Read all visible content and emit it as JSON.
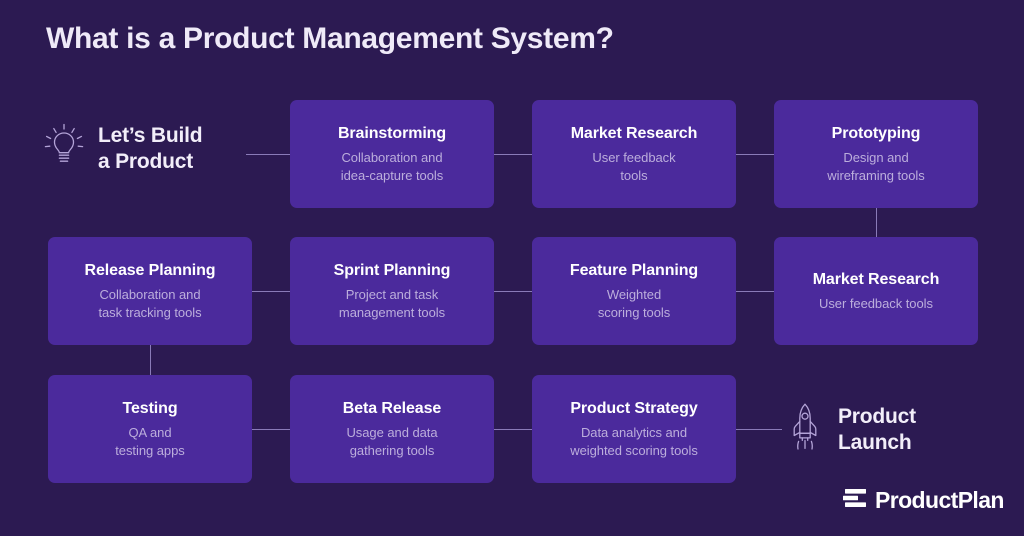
{
  "header": {
    "title": "What is a Product Management System?"
  },
  "colors": {
    "background": "#2C1A52",
    "card": "#4B2A9C",
    "title_text": "#EFEAF8",
    "card_title_text": "#FFFFFF",
    "card_subtitle_text": "#BCAEDC",
    "connector": "#8A7BB8",
    "icon_stroke": "#B4A4D8"
  },
  "start": {
    "icon": "lightbulb-icon",
    "label": "Let’s Build\na Product"
  },
  "end": {
    "icon": "rocket-icon",
    "label": "Product\nLaunch"
  },
  "cards": [
    {
      "title": "Brainstorming",
      "subtitle": "Collaboration and\nidea-capture tools",
      "row": 1,
      "col": 2
    },
    {
      "title": "Market Research",
      "subtitle": "User feedback\ntools",
      "row": 1,
      "col": 3
    },
    {
      "title": "Prototyping",
      "subtitle": "Design and\nwireframing tools",
      "row": 1,
      "col": 4
    },
    {
      "title": "Release Planning",
      "subtitle": "Collaboration and\ntask tracking tools",
      "row": 2,
      "col": 1
    },
    {
      "title": "Sprint Planning",
      "subtitle": "Project and task\nmanagement tools",
      "row": 2,
      "col": 2
    },
    {
      "title": "Feature Planning",
      "subtitle": "Weighted\nscoring tools",
      "row": 2,
      "col": 3
    },
    {
      "title": "Market Research",
      "subtitle": "User feedback tools",
      "row": 2,
      "col": 4
    },
    {
      "title": "Testing",
      "subtitle": "QA and\ntesting apps",
      "row": 3,
      "col": 1
    },
    {
      "title": "Beta Release",
      "subtitle": "Usage and data\ngathering tools",
      "row": 3,
      "col": 2
    },
    {
      "title": "Product Strategy",
      "subtitle": "Data analytics and\nweighted scoring tools",
      "row": 3,
      "col": 3
    }
  ],
  "brand": {
    "mark": "productplan-bars-logo",
    "name": "ProductPlan"
  }
}
